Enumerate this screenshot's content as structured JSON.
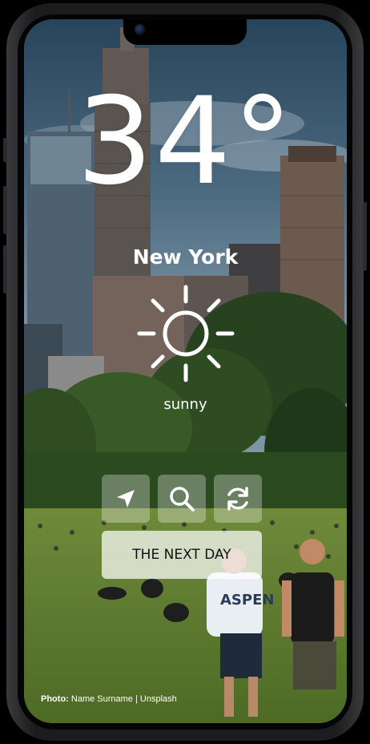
{
  "weather": {
    "temperature": "34",
    "degree_symbol": "°",
    "city": "New York",
    "condition": "sunny",
    "condition_icon": "sun-icon"
  },
  "controls": {
    "location_icon": "navigation-arrow-icon",
    "search_icon": "search-icon",
    "refresh_icon": "refresh-icon",
    "next_day_label": "THE NEXT DAY"
  },
  "credit": {
    "label": "Photo:",
    "text": "Name Surname | Unsplash"
  }
}
